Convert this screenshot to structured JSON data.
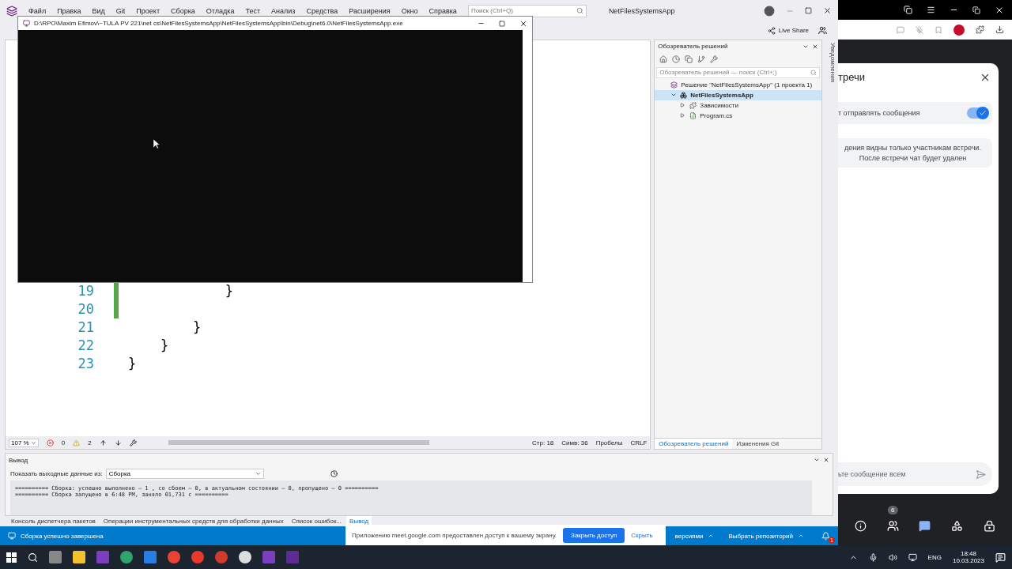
{
  "vs": {
    "menu": [
      "Файл",
      "Правка",
      "Вид",
      "Git",
      "Проект",
      "Сборка",
      "Отладка",
      "Тест",
      "Анализ",
      "Средства",
      "Расширения",
      "Окно",
      "Справка"
    ],
    "search": {
      "placeholder": "Поиск (Ctrl+Q)"
    },
    "solution_name": "NetFilesSystemsApp",
    "live_share": "Live Share"
  },
  "console": {
    "title": "D:\\RPO\\Maxim Efimov\\~TULA PV 221\\net cs\\NetFilesSystemsApp\\NetFilesSystemsApp\\bin\\Debug\\net6.0\\NetFilesSystemsApp.exe"
  },
  "editor": {
    "lines": [
      {
        "number": "19",
        "code": "            }",
        "changed": true
      },
      {
        "number": "20",
        "changed": true
      },
      {
        "number": "21",
        "code": "        }",
        "changed": false
      },
      {
        "number": "22",
        "code": "    }",
        "changed": false
      },
      {
        "number": "23",
        "code": "}",
        "changed": false
      }
    ],
    "status": {
      "zoom": "107 %",
      "errors": "0",
      "warnings": "2",
      "line": "Стр: 18",
      "column": "Симв: 36",
      "spacing": "Пробелы",
      "eol": "CRLF"
    }
  },
  "solution_explorer": {
    "title": "Обозреватель решений",
    "search": {
      "placeholder": "Обозреватель решений — поиск (Ctrl+;)"
    },
    "tree": [
      {
        "label": "Решение \"NetFilesSystemsApp\" (1 проекта 1)",
        "kind": "solution",
        "selected": false,
        "children": [
          {
            "label": "NetFilesSystemsApp",
            "kind": "project",
            "expanded": true,
            "selected": true,
            "children": [
              {
                "label": "Зависимости",
                "kind": "dependencies",
                "expanded": false,
                "selected": false
              },
              {
                "label": "Program.cs",
                "kind": "csharp",
                "expanded": false,
                "selected": false
              }
            ]
          }
        ]
      }
    ],
    "tabs": [
      {
        "label": "Обозреватель решений",
        "selected": true
      },
      {
        "label": "Изменения Git",
        "selected": false
      }
    ]
  },
  "notifications_label": "Уведомления",
  "output": {
    "title": "Вывод",
    "source_label": "Показать выходные данные из:",
    "source": "Сборка",
    "lines": [
      "========== Сборка: успешно выполнено — 1 , со сбоем — 0, в актуальном состоянии — 0, пропущено — 0 ==========",
      "========== Сборка запущено в 6:48 PM, заняло 01,731 с =========="
    ]
  },
  "bottom_tabs": [
    {
      "label": "Консоль диспетчера пакетов",
      "selected": false
    },
    {
      "label": "Операции инструментальных средств для обработки данных",
      "selected": false
    },
    {
      "label": "Список ошибок...",
      "selected": false
    },
    {
      "label": "Вывод",
      "selected": true
    }
  ],
  "status_bar": {
    "message": "Сборка успешно завершена",
    "source_control": "версиями",
    "repository": "Выбрать репозиторий",
    "notifications": "1"
  },
  "share_bar": {
    "message": "Приложению meet.google.com предоставлен доступ к вашему экрану.",
    "stop": "Закрыть доступ",
    "hide": "Скрыть"
  },
  "meet": {
    "title": "тречи",
    "toggle": {
      "label": "т отправлять сообщения",
      "on": true
    },
    "notice": "дения видны только участникам встречи. После встречи чат будет удален",
    "input": {
      "placeholder": "ьте сообщение всем"
    },
    "participants": "6"
  },
  "taskbar": {
    "language": "ENG",
    "time": "18:48",
    "date": "10.03.2023"
  }
}
